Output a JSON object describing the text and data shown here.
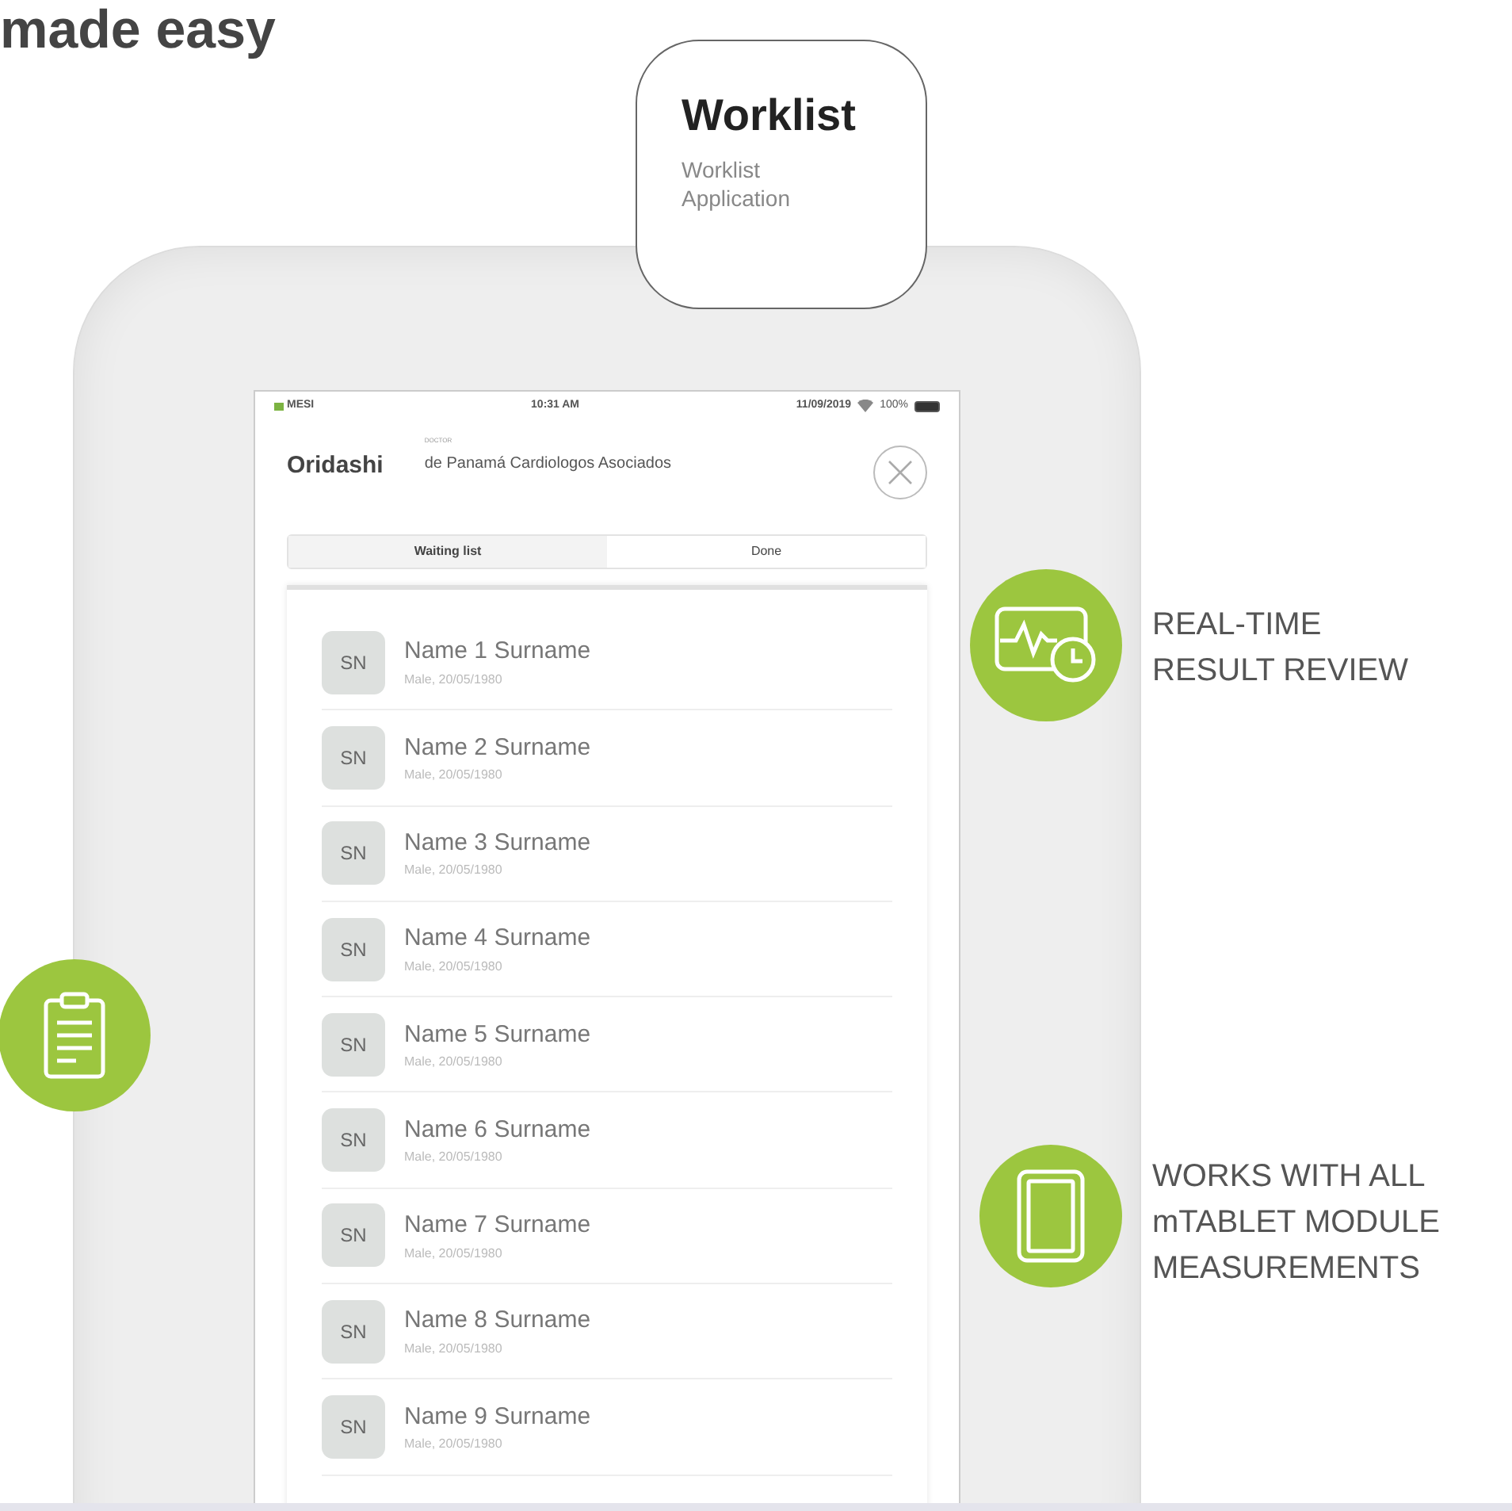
{
  "heading": "made easy",
  "app_card": {
    "title": "Worklist",
    "subtitle": [
      "Worklist",
      "Application"
    ]
  },
  "status_bar": {
    "carrier": "MESI",
    "time": "10:31 AM",
    "date": "11/09/2019",
    "battery": "100%"
  },
  "header": {
    "title": "Oridashi",
    "doctor_label": "DOCTOR",
    "doctor": "de Panamá Cardiologos Asociados"
  },
  "tabs": [
    {
      "label": "Waiting list",
      "selected": true
    },
    {
      "label": "Done",
      "selected": false
    }
  ],
  "patients": [
    {
      "initials": "SN",
      "name": "Name 1 Surname",
      "details": "Male, 20/05/1980"
    },
    {
      "initials": "SN",
      "name": "Name 2 Surname",
      "details": "Male, 20/05/1980"
    },
    {
      "initials": "SN",
      "name": "Name 3 Surname",
      "details": "Male, 20/05/1980"
    },
    {
      "initials": "SN",
      "name": "Name 4 Surname",
      "details": "Male, 20/05/1980"
    },
    {
      "initials": "SN",
      "name": "Name 5 Surname",
      "details": "Male, 20/05/1980"
    },
    {
      "initials": "SN",
      "name": "Name 6 Surname",
      "details": "Male, 20/05/1980"
    },
    {
      "initials": "SN",
      "name": "Name 7 Surname",
      "details": "Male, 20/05/1980"
    },
    {
      "initials": "SN",
      "name": "Name 8 Surname",
      "details": "Male, 20/05/1980"
    },
    {
      "initials": "SN",
      "name": "Name 9 Surname",
      "details": "Male, 20/05/1980"
    }
  ],
  "features": [
    {
      "kind": "monitor",
      "lines": [
        "REAL-TIME",
        "RESULT REVIEW"
      ]
    },
    {
      "kind": "clipboard"
    },
    {
      "kind": "tablet",
      "lines": [
        "WORKS WITH ALL",
        "mTABLET MODULE",
        "MEASUREMENTS"
      ]
    }
  ]
}
